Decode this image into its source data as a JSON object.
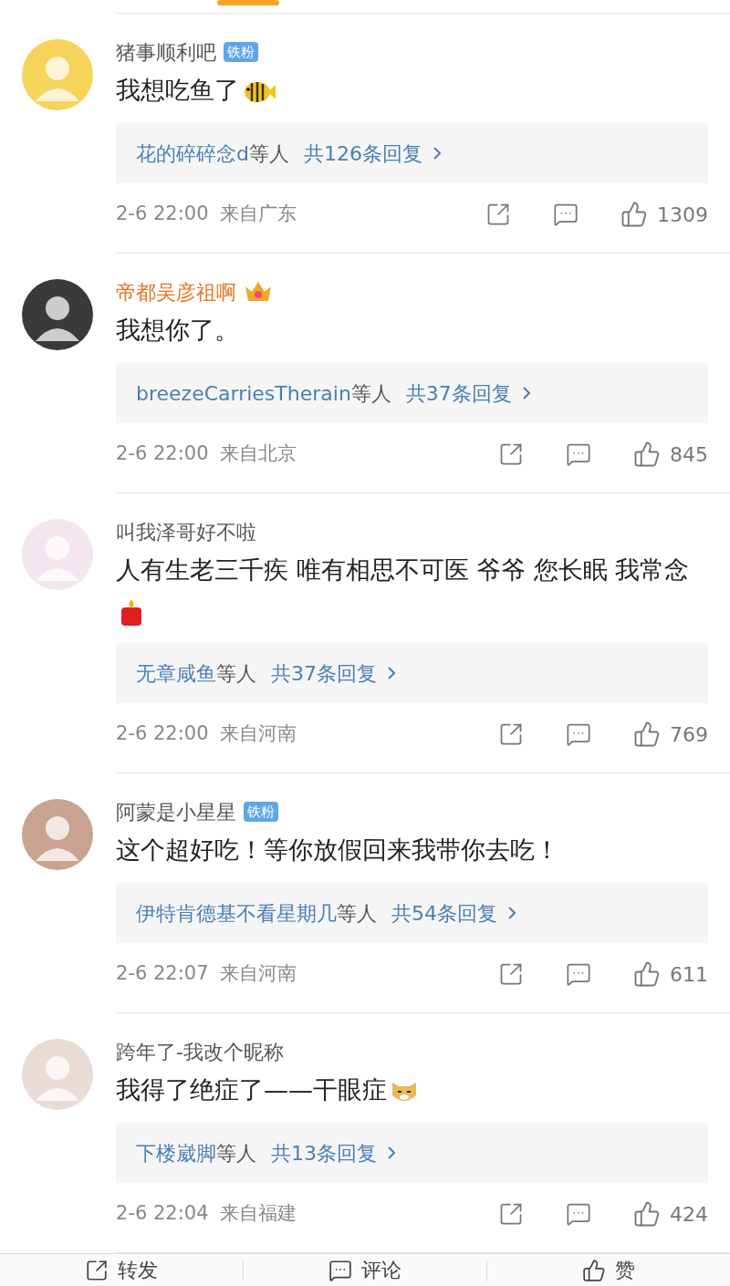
{
  "comments": [
    {
      "name": "猪事顺利吧",
      "vip": false,
      "badge": {
        "kind": "fan",
        "label": "铁粉"
      },
      "text": "我想吃鱼了",
      "emoji": {
        "kind": "fish"
      },
      "reply_users": "花的碎碎念d",
      "reply_suffix": "等人",
      "reply_count": "共126条回复",
      "time": "2-6 22:00",
      "location": "来自广东",
      "likes": "1309"
    },
    {
      "name": "帝都吴彦祖啊",
      "vip": true,
      "badge": {
        "kind": "crown"
      },
      "text": "我想你了。",
      "reply_users": "breezeCarriesTherain",
      "reply_suffix": "等人",
      "reply_count": "共37条回复",
      "time": "2-6 22:00",
      "location": "来自北京",
      "likes": "845"
    },
    {
      "name": "叫我泽哥好不啦",
      "vip": false,
      "text": "人有生老三千疾 唯有相思不可医 爷爷 您长眠 我常念",
      "emoji": {
        "kind": "candle"
      },
      "reply_users": "无章咸鱼",
      "reply_suffix": "等人",
      "reply_count": "共37条回复",
      "time": "2-6 22:00",
      "location": "来自河南",
      "likes": "769"
    },
    {
      "name": "阿蒙是小星星",
      "vip": false,
      "badge": {
        "kind": "fan",
        "label": "铁粉"
      },
      "text": "这个超好吃！等你放假回来我带你去吃！",
      "reply_users": "伊特肯德基不看星期几",
      "reply_suffix": "等人",
      "reply_count": "共54条回复",
      "time": "2-6 22:07",
      "location": "来自河南",
      "likes": "611"
    },
    {
      "name": "跨年了-我改个昵称",
      "vip": false,
      "text": "我得了绝症了——干眼症",
      "emoji": {
        "kind": "dog"
      },
      "reply_users": "下楼崴脚",
      "reply_suffix": "等人",
      "reply_count": "共13条回复",
      "time": "2-6 22:04",
      "location": "来自福建",
      "likes": "424"
    }
  ],
  "bottom_bar": [
    {
      "kind": "share",
      "label": "转发"
    },
    {
      "kind": "comment",
      "label": "评论"
    },
    {
      "kind": "like",
      "label": "赞"
    }
  ]
}
